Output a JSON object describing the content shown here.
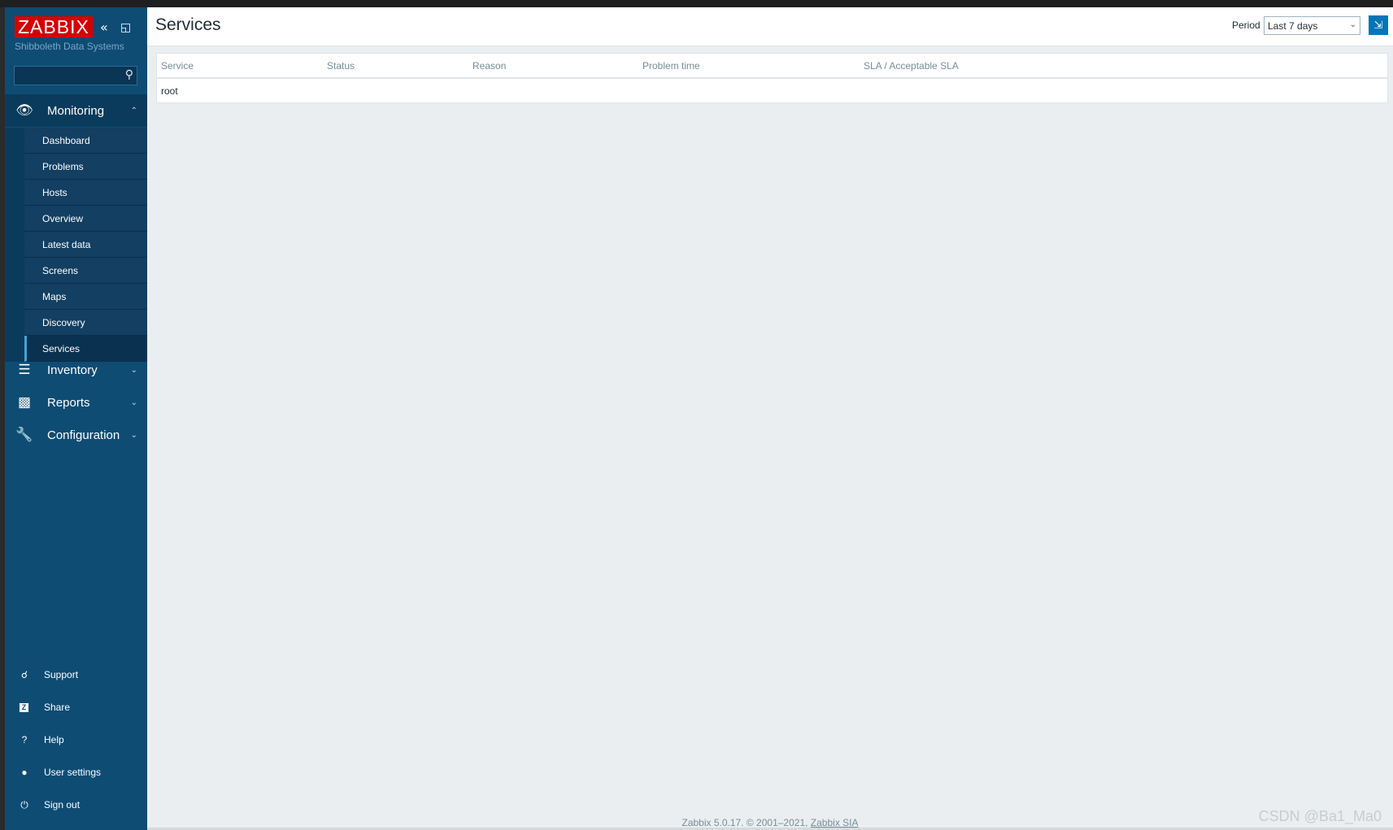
{
  "app": {
    "logo_text": "ZABBIX",
    "subtitle": "Shibboleth Data Systems",
    "collapse_icon": "«",
    "kiosk_icon": "◱"
  },
  "search": {
    "placeholder": ""
  },
  "menu": {
    "monitoring": "Monitoring",
    "inventory": "Inventory",
    "reports": "Reports",
    "configuration": "Configuration",
    "monitoring_items": [
      "Dashboard",
      "Problems",
      "Hosts",
      "Overview",
      "Latest data",
      "Screens",
      "Maps",
      "Discovery",
      "Services"
    ],
    "active_item": "Services"
  },
  "bottom_menu": {
    "support": "Support",
    "share": "Share",
    "help": "Help",
    "user_settings": "User settings",
    "sign_out": "Sign out"
  },
  "header": {
    "title": "Services",
    "period_label": "Period",
    "period_value": "Last 7 days"
  },
  "table": {
    "columns": [
      "Service",
      "Status",
      "Reason",
      "Problem time",
      "SLA / Acceptable SLA"
    ],
    "rows": [
      [
        "root",
        "",
        "",
        "",
        ""
      ]
    ]
  },
  "footer": {
    "text": "Zabbix 5.0.17. © 2001–2021, ",
    "link": "Zabbix SIA"
  },
  "watermark": "CSDN @Ba1_Ma0",
  "colors": {
    "sidebar": "#0e4c74",
    "logo": "#d40000",
    "accent": "#0275b8"
  }
}
